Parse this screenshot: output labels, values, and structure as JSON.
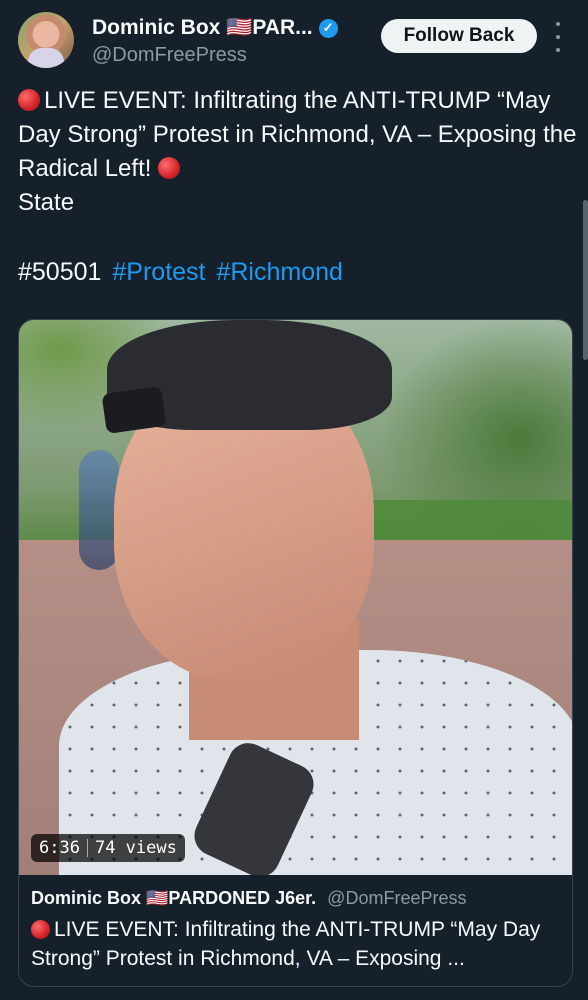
{
  "author": {
    "display_name": "Dominic Box 🇺🇸PAR...",
    "handle": "@DomFreePress",
    "verified_icon": "verified-badge-icon"
  },
  "actions": {
    "follow_label": "Follow Back",
    "more_icon": "more-options-icon"
  },
  "tweet": {
    "line1_prefix_icon": "red-circle-icon",
    "text_line1": "LIVE EVENT: Infiltrating the ANTI-TRUMP “May Day Strong” Protest in Richmond, VA – Exposing the Radical Left!",
    "text_line_state": "State",
    "hashtag_plain": "#50501",
    "hashtags": [
      "#Protest",
      "#Richmond"
    ]
  },
  "media": {
    "duration": "6:36",
    "views": "74 views"
  },
  "quoted": {
    "display_name": "Dominic Box 🇺🇸PARDONED J6er.",
    "handle": "@DomFreePress",
    "text": "LIVE EVENT: Infiltrating the ANTI-TRUMP “May Day Strong” Protest in Richmond, VA – Exposing ..."
  },
  "colors": {
    "background": "#15202b",
    "accent": "#1d9bf0",
    "secondary_text": "#8b98a5"
  }
}
